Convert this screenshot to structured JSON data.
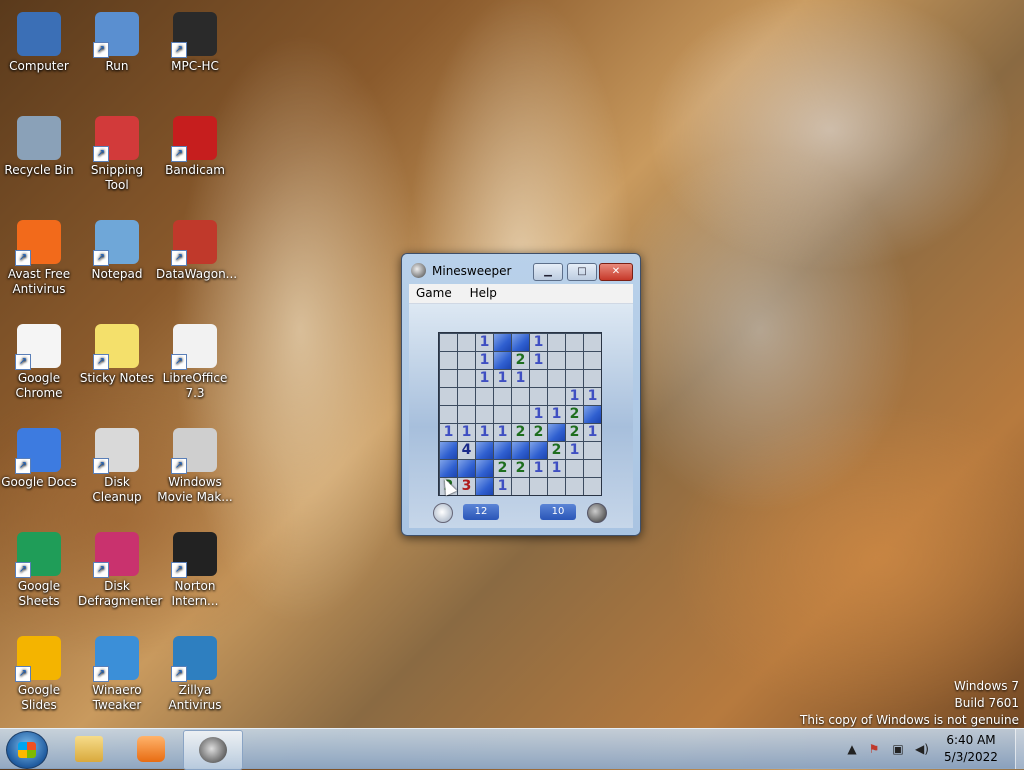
{
  "desktop": {
    "icons": [
      {
        "label": "Computer",
        "icon": "computer-icon",
        "color": "#3b6fb6"
      },
      {
        "label": "Run",
        "icon": "run-icon",
        "color": "#5a8fd0"
      },
      {
        "label": "MPC-HC",
        "icon": "mpc-hc-icon",
        "color": "#2a2a2a"
      },
      {
        "label": "Recycle Bin",
        "icon": "recycle-bin-icon",
        "color": "#8aa1b8"
      },
      {
        "label": "Snipping Tool",
        "icon": "snipping-tool-icon",
        "color": "#d23a3a"
      },
      {
        "label": "Bandicam",
        "icon": "bandicam-icon",
        "color": "#c61e1e"
      },
      {
        "label": "Avast Free Antivirus",
        "icon": "avast-icon",
        "color": "#f26a1b"
      },
      {
        "label": "Notepad",
        "icon": "notepad-icon",
        "color": "#6fa7d8"
      },
      {
        "label": "DataWagon...",
        "icon": "datawagon-icon",
        "color": "#c0392b"
      },
      {
        "label": "Google Chrome",
        "icon": "google-chrome-icon",
        "color": "#f5f5f5"
      },
      {
        "label": "Sticky Notes",
        "icon": "sticky-notes-icon",
        "color": "#f4e06b"
      },
      {
        "label": "LibreOffice 7.3",
        "icon": "libreoffice-icon",
        "color": "#f2f2f2"
      },
      {
        "label": "Google Docs",
        "icon": "google-docs-icon",
        "color": "#3d7be0"
      },
      {
        "label": "Disk Cleanup",
        "icon": "disk-cleanup-icon",
        "color": "#d9d9d9"
      },
      {
        "label": "Windows Movie Mak...",
        "icon": "movie-maker-icon",
        "color": "#cfcfcf"
      },
      {
        "label": "Google Sheets",
        "icon": "google-sheets-icon",
        "color": "#1f9d58"
      },
      {
        "label": "Disk Defragmenter",
        "icon": "disk-defragmenter-icon",
        "color": "#c9326e"
      },
      {
        "label": "Norton Intern...",
        "icon": "norton-icon",
        "color": "#222222"
      },
      {
        "label": "Google Slides",
        "icon": "google-slides-icon",
        "color": "#f4b400"
      },
      {
        "label": "Winaero Tweaker",
        "icon": "winaero-tweaker-icon",
        "color": "#3b8fd8"
      },
      {
        "label": "Zillya Antivirus",
        "icon": "zillya-icon",
        "color": "#2e7fc0"
      }
    ]
  },
  "minesweeper": {
    "title": "Minesweeper",
    "menu": [
      "Game",
      "Help"
    ],
    "board": [
      [
        "r",
        "r",
        "1",
        "c",
        "c",
        "1",
        "r",
        "r",
        "r"
      ],
      [
        "r",
        "r",
        "1",
        "c",
        "2",
        "1",
        "r",
        "r",
        "r"
      ],
      [
        "r",
        "r",
        "1",
        "1",
        "1",
        "r",
        "r",
        "r",
        "r"
      ],
      [
        "r",
        "r",
        "r",
        "r",
        "r",
        "r",
        "r",
        "1",
        "1"
      ],
      [
        "r",
        "r",
        "r",
        "r",
        "r",
        "1",
        "1",
        "2",
        "c"
      ],
      [
        "1",
        "1",
        "1",
        "1",
        "2",
        "2",
        "c",
        "2",
        "1"
      ],
      [
        "c",
        "4",
        "c",
        "c",
        "c",
        "c",
        "2",
        "1",
        "r"
      ],
      [
        "c",
        "c",
        "c",
        "2",
        "2",
        "1",
        "1",
        "r",
        "r"
      ],
      [
        "2",
        "3",
        "c",
        "1",
        "r",
        "r",
        "r",
        "r",
        "r"
      ]
    ],
    "timer": "12",
    "mines_left": "10"
  },
  "watermark": {
    "line1": "Windows 7",
    "line2": "Build 7601",
    "line3": "This copy of Windows is not genuine"
  },
  "taskbar": {
    "clock_time": "6:40 AM",
    "clock_date": "5/3/2022"
  }
}
